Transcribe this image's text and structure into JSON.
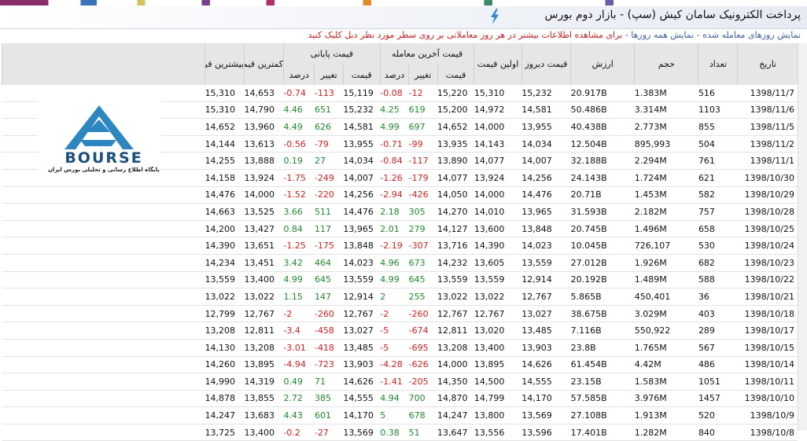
{
  "title": "پرداخت الکترونیک سامان کیش (سپ) - بازار دوم بورس",
  "info": {
    "link_traded": "نمایش روزهای معامله شده",
    "link_all": "نمایش همه روزها",
    "hint": "برای مشاهده اطلاعات بیشتر در هر روز معاملاتی بر روی سطر مورد نظر دبل کلیک کنید",
    "sep": "-"
  },
  "logo": {
    "word": "BOURSE",
    "tag": "پایگاه اطلاع رسانی و تحلیلی بورس ایران"
  },
  "headers": {
    "date": "تاریخ",
    "count": "تعداد",
    "volume": "حجم",
    "value": "ارزش",
    "yesterday": "قیمت دیروز",
    "first": "اولین قیمت",
    "last_group": "قیمت آخرین معامله",
    "close_group": "قیمت پایانی",
    "price": "قیمت",
    "change": "تغییر",
    "percent": "درصد",
    "low": "کمترین قیمت",
    "high": "بیشترین قیمت"
  },
  "rows": [
    {
      "date": "1398/11/7",
      "count": "516",
      "volume": "1.383M",
      "value": "20.917B",
      "yesterday": "15,232",
      "first": "15,310",
      "last_price": "15,220",
      "last_change": "-12",
      "last_pct": "-0.08",
      "close_price": "15,119",
      "close_change": "-113",
      "close_pct": "-0.74",
      "low": "14,653",
      "high": "15,310"
    },
    {
      "date": "1398/11/6",
      "count": "1103",
      "volume": "3.314M",
      "value": "50.486B",
      "yesterday": "14,581",
      "first": "14,972",
      "last_price": "15,200",
      "last_change": "619",
      "last_pct": "4.25",
      "close_price": "15,232",
      "close_change": "651",
      "close_pct": "4.46",
      "low": "14,790",
      "high": "15,310"
    },
    {
      "date": "1398/11/5",
      "count": "855",
      "volume": "2.773M",
      "value": "40.438B",
      "yesterday": "13,955",
      "first": "14,000",
      "last_price": "14,652",
      "last_change": "697",
      "last_pct": "4.99",
      "close_price": "14,581",
      "close_change": "626",
      "close_pct": "4.49",
      "low": "13,960",
      "high": "14,652"
    },
    {
      "date": "1398/11/2",
      "count": "504",
      "volume": "895,993",
      "value": "12.504B",
      "yesterday": "14,034",
      "first": "14,143",
      "last_price": "13,935",
      "last_change": "-99",
      "last_pct": "-0.71",
      "close_price": "13,955",
      "close_change": "-79",
      "close_pct": "-0.56",
      "low": "13,613",
      "high": "14,144"
    },
    {
      "date": "1398/11/1",
      "count": "761",
      "volume": "2.294M",
      "value": "32.188B",
      "yesterday": "14,007",
      "first": "14,077",
      "last_price": "13,890",
      "last_change": "-117",
      "last_pct": "-0.84",
      "close_price": "14,034",
      "close_change": "27",
      "close_pct": "0.19",
      "low": "13,888",
      "high": "14,255"
    },
    {
      "date": "1398/10/30",
      "count": "621",
      "volume": "1.724M",
      "value": "24.143B",
      "yesterday": "14,256",
      "first": "13,924",
      "last_price": "14,077",
      "last_change": "-179",
      "last_pct": "-1.26",
      "close_price": "14,007",
      "close_change": "-249",
      "close_pct": "-1.75",
      "low": "13,924",
      "high": "14,158"
    },
    {
      "date": "1398/10/29",
      "count": "582",
      "volume": "1.453M",
      "value": "20.71B",
      "yesterday": "14,476",
      "first": "14,000",
      "last_price": "14,050",
      "last_change": "-426",
      "last_pct": "-2.94",
      "close_price": "14,256",
      "close_change": "-220",
      "close_pct": "-1.52",
      "low": "14,000",
      "high": "14,476"
    },
    {
      "date": "1398/10/28",
      "count": "757",
      "volume": "2.182M",
      "value": "31.593B",
      "yesterday": "13,965",
      "first": "14,010",
      "last_price": "14,270",
      "last_change": "305",
      "last_pct": "2.18",
      "close_price": "14,476",
      "close_change": "511",
      "close_pct": "3.66",
      "low": "13,525",
      "high": "14,663"
    },
    {
      "date": "1398/10/25",
      "count": "658",
      "volume": "1.496M",
      "value": "20.745B",
      "yesterday": "13,848",
      "first": "13,600",
      "last_price": "14,127",
      "last_change": "279",
      "last_pct": "2.01",
      "close_price": "13,965",
      "close_change": "117",
      "close_pct": "0.84",
      "low": "13,427",
      "high": "14,200"
    },
    {
      "date": "1398/10/24",
      "count": "530",
      "volume": "726,107",
      "value": "10.045B",
      "yesterday": "14,023",
      "first": "14,390",
      "last_price": "13,716",
      "last_change": "-307",
      "last_pct": "-2.19",
      "close_price": "13,848",
      "close_change": "-175",
      "close_pct": "-1.25",
      "low": "13,651",
      "high": "14,390"
    },
    {
      "date": "1398/10/23",
      "count": "682",
      "volume": "1.926M",
      "value": "27.012B",
      "yesterday": "13,559",
      "first": "13,605",
      "last_price": "14,232",
      "last_change": "673",
      "last_pct": "4.96",
      "close_price": "14,023",
      "close_change": "464",
      "close_pct": "3.42",
      "low": "13,451",
      "high": "14,234"
    },
    {
      "date": "1398/10/22",
      "count": "588",
      "volume": "1.489M",
      "value": "20.192B",
      "yesterday": "12,914",
      "first": "13,559",
      "last_price": "13,559",
      "last_change": "645",
      "last_pct": "4.99",
      "close_price": "13,559",
      "close_change": "645",
      "close_pct": "4.99",
      "low": "13,400",
      "high": "13,559"
    },
    {
      "date": "1398/10/21",
      "count": "36",
      "volume": "450,401",
      "value": "5.865B",
      "yesterday": "12,767",
      "first": "13,022",
      "last_price": "13,022",
      "last_change": "255",
      "last_pct": "2",
      "close_price": "12,914",
      "close_change": "147",
      "close_pct": "1.15",
      "low": "13,022",
      "high": "13,022"
    },
    {
      "date": "1398/10/18",
      "count": "403",
      "volume": "3.029M",
      "value": "38.675B",
      "yesterday": "13,027",
      "first": "12,767",
      "last_price": "12,767",
      "last_change": "-260",
      "last_pct": "-2",
      "close_price": "12,767",
      "close_change": "-260",
      "close_pct": "-2",
      "low": "12,767",
      "high": "12,799"
    },
    {
      "date": "1398/10/17",
      "count": "289",
      "volume": "550,922",
      "value": "7.116B",
      "yesterday": "13,485",
      "first": "13,020",
      "last_price": "12,811",
      "last_change": "-674",
      "last_pct": "-5",
      "close_price": "13,027",
      "close_change": "-458",
      "close_pct": "-3.4",
      "low": "12,811",
      "high": "13,208"
    },
    {
      "date": "1398/10/15",
      "count": "567",
      "volume": "1.765M",
      "value": "23.8B",
      "yesterday": "13,903",
      "first": "13,400",
      "last_price": "13,208",
      "last_change": "-695",
      "last_pct": "-5",
      "close_price": "13,485",
      "close_change": "-418",
      "close_pct": "-3.01",
      "low": "13,208",
      "high": "14,130"
    },
    {
      "date": "1398/10/14",
      "count": "486",
      "volume": "4.42M",
      "value": "61.454B",
      "yesterday": "14,626",
      "first": "13,895",
      "last_price": "14,000",
      "last_change": "-626",
      "last_pct": "-4.28",
      "close_price": "13,903",
      "close_change": "-723",
      "close_pct": "-4.94",
      "low": "13,895",
      "high": "14,260"
    },
    {
      "date": "1398/10/11",
      "count": "1051",
      "volume": "1.583M",
      "value": "23.15B",
      "yesterday": "14,555",
      "first": "14,500",
      "last_price": "14,350",
      "last_change": "-205",
      "last_pct": "-1.41",
      "close_price": "14,626",
      "close_change": "71",
      "close_pct": "0.49",
      "low": "14,319",
      "high": "14,990"
    },
    {
      "date": "1398/10/10",
      "count": "1457",
      "volume": "3.976M",
      "value": "57.585B",
      "yesterday": "14,170",
      "first": "14,799",
      "last_price": "14,870",
      "last_change": "700",
      "last_pct": "4.94",
      "close_price": "14,555",
      "close_change": "385",
      "close_pct": "2.72",
      "low": "13,855",
      "high": "14,878"
    },
    {
      "date": "1398/10/9",
      "count": "520",
      "volume": "1.913M",
      "value": "27.108B",
      "yesterday": "13,569",
      "first": "13,800",
      "last_price": "14,247",
      "last_change": "678",
      "last_pct": "5",
      "close_price": "14,170",
      "close_change": "601",
      "close_pct": "4.43",
      "low": "13,683",
      "high": "14,247"
    },
    {
      "date": "1398/10/8",
      "count": "840",
      "volume": "1.282M",
      "value": "17.401B",
      "yesterday": "13,596",
      "first": "13,556",
      "last_price": "13,647",
      "last_change": "51",
      "last_pct": "0.38",
      "close_price": "13,569",
      "close_change": "-27",
      "close_pct": "-0.2",
      "low": "13,400",
      "high": "13,725"
    }
  ]
}
